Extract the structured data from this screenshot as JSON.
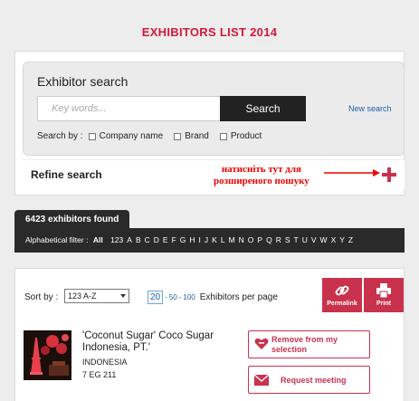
{
  "page": {
    "title": "EXHIBITORS LIST 2014"
  },
  "search": {
    "heading": "Exhibitor search",
    "placeholder": "Key words...",
    "button_label": "Search",
    "new_search": "New search",
    "search_by_label": "Search by :",
    "options": [
      "Company name",
      "Brand",
      "Product"
    ]
  },
  "refine": {
    "label": "Refine search",
    "annotation_line1": "натисніть тут для",
    "annotation_line2": "розширеного пошуку",
    "icon": "plus-icon"
  },
  "results": {
    "found_label": "6423 exhibitors found",
    "alpha_label": "Alphabetical filter :",
    "alpha_all": "All",
    "alpha_letters": [
      "123",
      "A",
      "B",
      "C",
      "D",
      "E",
      "F",
      "G",
      "H",
      "I",
      "J",
      "K",
      "L",
      "M",
      "N",
      "O",
      "P",
      "Q",
      "R",
      "S",
      "T",
      "U",
      "V",
      "W",
      "X",
      "Y",
      "Z"
    ],
    "sort_label": "Sort by :",
    "sort_value": "123 A-Z",
    "per_page_active": "20",
    "per_page_sep1": "-",
    "per_page_option1": "50",
    "per_page_sep2": "-",
    "per_page_option2": "100",
    "per_page_suffix": "Exhibitors per page",
    "permalink_label": "Permalink",
    "print_label": "Print"
  },
  "exhibitor": {
    "name": "'Coconut Sugar' Coco Sugar Indonesia, PT.'",
    "country": "INDONESIA",
    "stand": "7 EG 211",
    "remove_label": "Remove from my selection",
    "request_label": "Request meeting"
  },
  "colors": {
    "accent": "#c9324d",
    "title": "#d6173a",
    "dark_bar": "#2a2a2a",
    "link": "#1e5fa3",
    "annotation": "#e00000"
  }
}
